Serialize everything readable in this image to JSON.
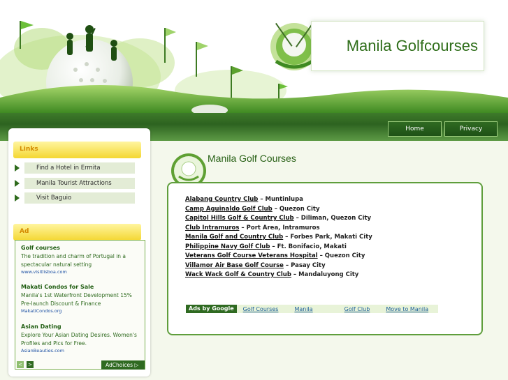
{
  "header": {
    "site_title": "Manila Golfcourses"
  },
  "nav": {
    "home_label": "Home",
    "privacy_label": "Privacy"
  },
  "sidebar": {
    "links_heading": "Links",
    "links": [
      {
        "label": "Find a Hotel in Ermita"
      },
      {
        "label": "Manila Tourist Attractions"
      },
      {
        "label": "Visit Baguio"
      }
    ],
    "ad_heading": "Ad",
    "ads": [
      {
        "title": "Golf courses",
        "text": "The tradition and charm of Portugal in a spectacular natural setting",
        "url": "www.visitlisboa.com"
      },
      {
        "title": "Makati Condos for Sale",
        "text": "Manila's 1st Waterfront Development 15% Pre-launch Discount & Finance",
        "url": "MakatiCondos.org"
      },
      {
        "title": "Asian Dating",
        "text": "Explore Your Asian Dating Desires. Women's Profiles and Pics for Free.",
        "url": "AsianBeauties.com"
      }
    ],
    "adchoices_label": "AdChoices",
    "prev_label": "<",
    "next_label": ">"
  },
  "main": {
    "heading": "Manila Golf Courses",
    "courses": [
      {
        "name": "Alabang Country Club",
        "location": " – Muntinlupa"
      },
      {
        "name": "Camp Aguinaldo Golf Club",
        "location": " – Quezon City"
      },
      {
        "name": "Capitol Hills Golf & Country Club",
        "location": " – Diliman, Quezon City"
      },
      {
        "name": "Club Intramuros",
        "location": " – Port Area, Intramuros"
      },
      {
        "name": "Manila Golf and Country Club",
        "location": " – Forbes Park, Makati City"
      },
      {
        "name": "Philippine Navy Golf Club",
        "location": " – Ft. Bonifacio, Makati"
      },
      {
        "name": "Veterans Golf Course Veterans Hospital",
        "location": " – Quezon City"
      },
      {
        "name": "Villamor Air Base Golf Course",
        "location": " – Pasay City"
      },
      {
        "name": "Wack Wack Golf & Country Club",
        "location": " – Mandaluyong City"
      }
    ],
    "ads_by_google": "Ads by Google",
    "ad_links": [
      "Golf Courses",
      "Manila",
      "Golf Club",
      "Move to Manila"
    ]
  },
  "colors": {
    "brand_green": "#2f6e1a",
    "accent_yellow": "#f4d732",
    "link_blue": "#1b5e9a"
  }
}
